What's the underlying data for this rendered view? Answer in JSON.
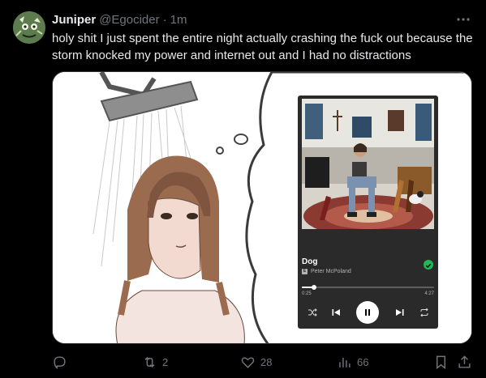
{
  "author": {
    "name": "Juniper",
    "handle": "@Egocider",
    "separator": "·",
    "time": "1m"
  },
  "tweet": {
    "text": "holy shit I just spent the entire night actually crashing the fuck out because the storm knocked my power and internet out and I had no distractions"
  },
  "media": {
    "player": {
      "song_title": "Dog",
      "artist": "Peter McPoland",
      "explicit_badge": "E",
      "elapsed": "0:25",
      "duration": "4:27",
      "progress_fraction": 0.095,
      "accent_color": "#1db954"
    }
  },
  "actions": {
    "reply_icon": "reply-icon",
    "retweet_count": "2",
    "like_count": "28",
    "view_count": "66",
    "bookmark_icon": "bookmark-icon",
    "share_icon": "share-icon"
  }
}
